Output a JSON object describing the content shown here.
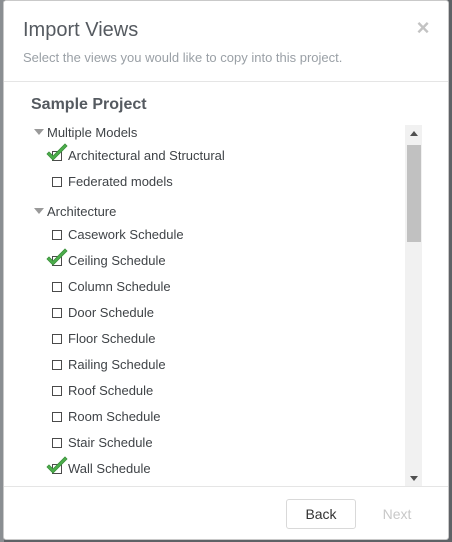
{
  "dialog": {
    "title": "Import Views",
    "subtitle": "Select the views you would like to copy into this project.",
    "close_label": "×"
  },
  "project": {
    "name": "Sample Project"
  },
  "groups": [
    {
      "label": "Multiple Models",
      "items": [
        {
          "label": "Architectural and Structural",
          "checked": true
        },
        {
          "label": "Federated models",
          "checked": false
        }
      ]
    },
    {
      "label": "Architecture",
      "items": [
        {
          "label": "Casework Schedule",
          "checked": false
        },
        {
          "label": "Ceiling Schedule",
          "checked": true
        },
        {
          "label": "Column Schedule",
          "checked": false
        },
        {
          "label": "Door Schedule",
          "checked": false
        },
        {
          "label": "Floor Schedule",
          "checked": false
        },
        {
          "label": "Railing Schedule",
          "checked": false
        },
        {
          "label": "Roof Schedule",
          "checked": false
        },
        {
          "label": "Room Schedule",
          "checked": false
        },
        {
          "label": "Stair Schedule",
          "checked": false
        },
        {
          "label": "Wall Schedule",
          "checked": true
        }
      ]
    }
  ],
  "footer": {
    "back_label": "Back",
    "next_label": "Next"
  },
  "colors": {
    "check": "#4cae4c",
    "title": "#555a60"
  }
}
